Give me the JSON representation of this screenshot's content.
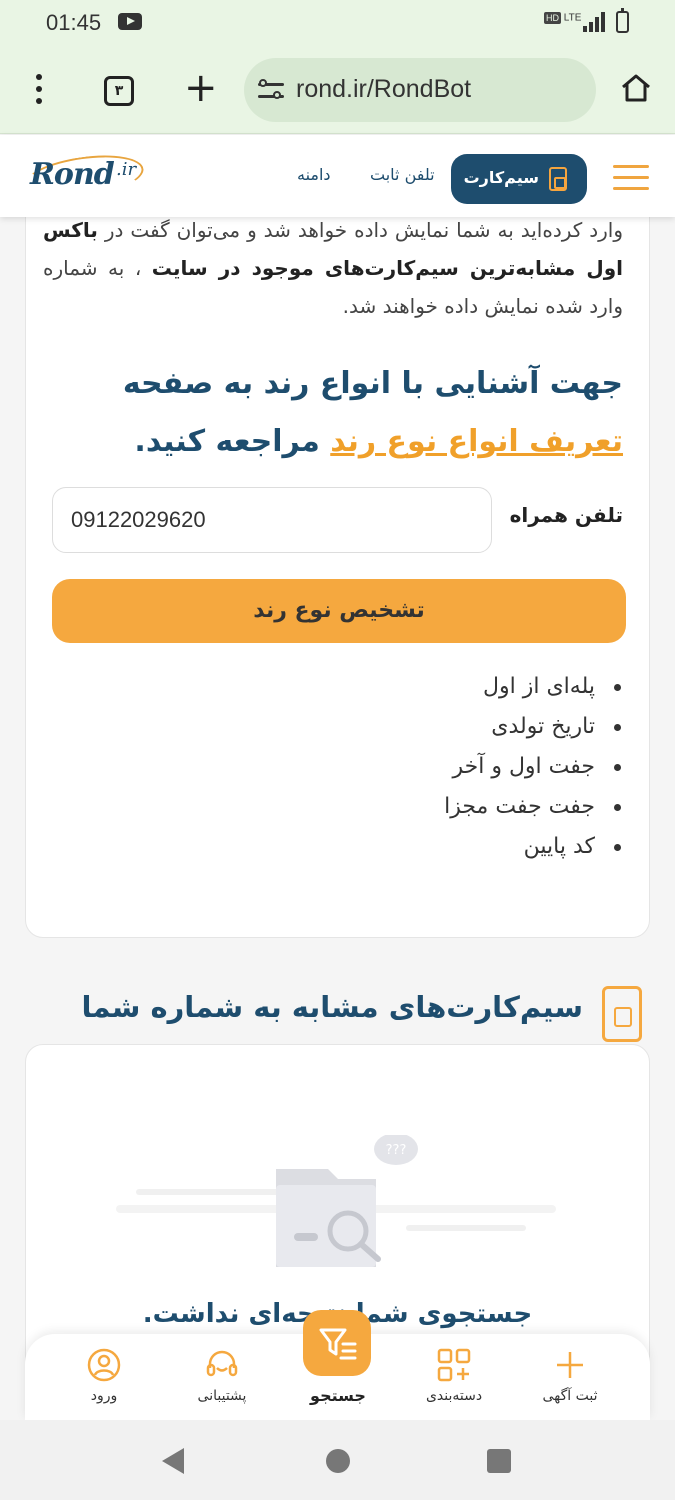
{
  "status_bar": {
    "time": "01:45",
    "network": "LTE",
    "hd": "HD"
  },
  "browser": {
    "tab_count": "۳",
    "url": "rond.ir/RondBot"
  },
  "header": {
    "logo_text": "Rond",
    "logo_suffix": ".ir",
    "sim_button": "سیم‌کارت",
    "nav_fixed_phone": "تلفن ثابت",
    "nav_domain": "دامنه"
  },
  "intro": {
    "text_1": "وارد کرده‌اید به شما نمایش داده خواهد شد و می‌توان گفت در ",
    "bold_1": "باکس اول مشابه‌ترین سیم‌کارت‌های موجود در سایت",
    "text_2": " ، به شماره وارد شده نمایش داده خواهند شد."
  },
  "info_heading": {
    "text_1": "جهت آشنایی با انواع رند به صفحه ",
    "link": "تعریف انواع نوع رند",
    "text_2": " مراجعه کنید."
  },
  "form": {
    "phone_label": "تلفن همراه",
    "phone_value": "09122029620",
    "submit_label": "تشخیص نوع رند"
  },
  "round_types": [
    "پله‌ای از اول",
    "تاریخ تولدی",
    "جفت اول و آخر",
    "جفت جفت مجزا",
    "کد پایین"
  ],
  "similar_section": {
    "title": "سیم‌کارت‌های مشابه به شماره شما",
    "empty_text": "جستجوی شما نتیجه‌ای نداشت.",
    "empty_badge": "???"
  },
  "bottom_nav": {
    "login": "ورود",
    "support": "پشتیبانی",
    "search": "جستجو",
    "categories": "دسته‌بندی",
    "post_ad": "ثبت آگهی"
  },
  "colors": {
    "primary": "#1e4d6e",
    "accent": "#f5a83f",
    "status_bg": "#e9f5e4"
  }
}
